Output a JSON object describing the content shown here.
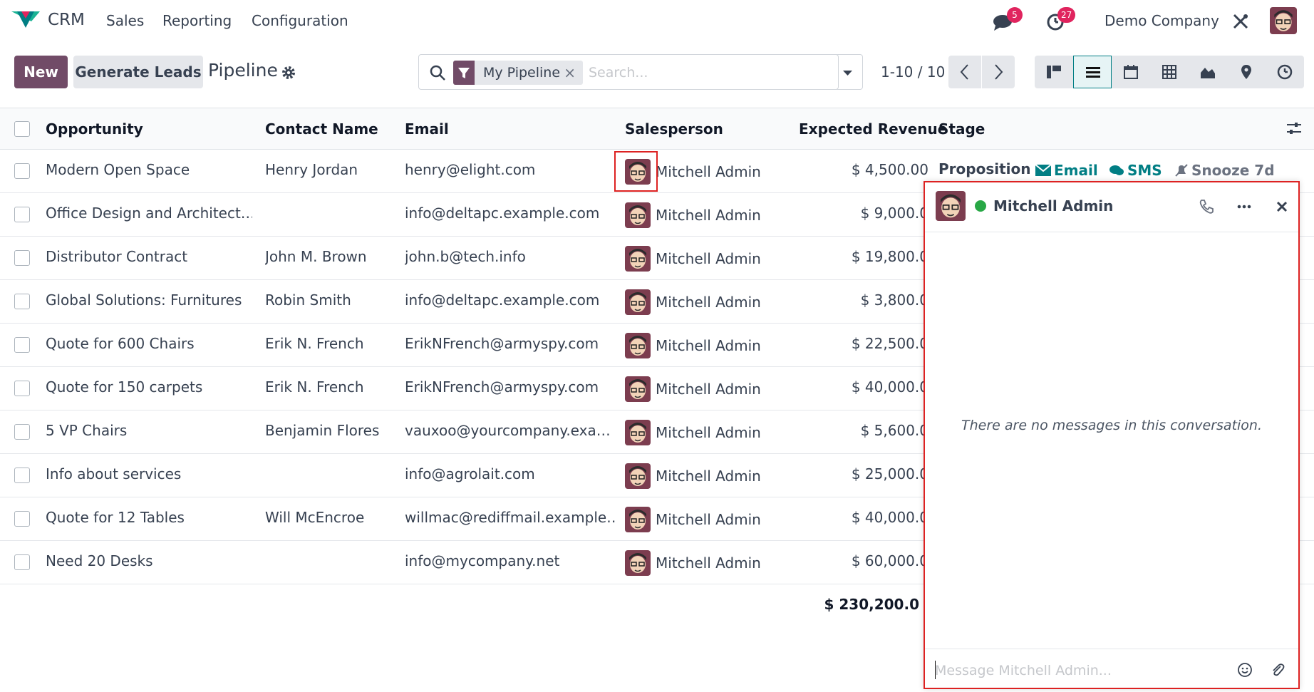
{
  "nav": {
    "app_name": "CRM",
    "menus": [
      "Sales",
      "Reporting",
      "Configuration"
    ],
    "messages_badge": "5",
    "activities_badge": "27",
    "company": "Demo Company",
    "icons": [
      "chat-icon",
      "clock-icon",
      "tools-icon"
    ]
  },
  "control": {
    "new_label": "New",
    "generate_label": "Generate Leads",
    "title": "Pipeline",
    "facet_label": "My Pipeline",
    "facet_close": "×",
    "search_placeholder": "Search...",
    "pager": "1-10 / 10",
    "views": [
      "kanban",
      "list",
      "calendar",
      "pivot",
      "graph",
      "map",
      "activity"
    ],
    "active_view": "list"
  },
  "list": {
    "headers": {
      "opportunity": "Opportunity",
      "contact": "Contact Name",
      "email": "Email",
      "salesperson": "Salesperson",
      "revenue": "Expected Revenue",
      "stage": "Stage"
    },
    "rows": [
      {
        "opportunity": "Modern Open Space",
        "contact": "Henry Jordan",
        "email": "henry@elight.com",
        "salesperson": "Mitchell Admin",
        "revenue": "$ 4,500.00"
      },
      {
        "opportunity": "Office Design and Architect…",
        "contact": "",
        "email": "info@deltapc.example.com",
        "salesperson": "Mitchell Admin",
        "revenue": "$ 9,000.0"
      },
      {
        "opportunity": "Distributor Contract",
        "contact": "John M. Brown",
        "email": "john.b@tech.info",
        "salesperson": "Mitchell Admin",
        "revenue": "$ 19,800.0"
      },
      {
        "opportunity": "Global Solutions: Furnitures",
        "contact": "Robin Smith",
        "email": "info@deltapc.example.com",
        "salesperson": "Mitchell Admin",
        "revenue": "$ 3,800.0"
      },
      {
        "opportunity": "Quote for 600 Chairs",
        "contact": "Erik N. French",
        "email": "ErikNFrench@armyspy.com",
        "salesperson": "Mitchell Admin",
        "revenue": "$ 22,500.0"
      },
      {
        "opportunity": "Quote for 150 carpets",
        "contact": "Erik N. French",
        "email": "ErikNFrench@armyspy.com",
        "salesperson": "Mitchell Admin",
        "revenue": "$ 40,000.0"
      },
      {
        "opportunity": "5 VP Chairs",
        "contact": "Benjamin Flores",
        "email": "vauxoo@yourcompany.exa…",
        "salesperson": "Mitchell Admin",
        "revenue": "$ 5,600.0"
      },
      {
        "opportunity": "Info about services",
        "contact": "",
        "email": "info@agrolait.com",
        "salesperson": "Mitchell Admin",
        "revenue": "$ 25,000.0"
      },
      {
        "opportunity": "Quote for 12 Tables",
        "contact": "Will McEncroe",
        "email": "willmac@rediffmail.example…",
        "salesperson": "Mitchell Admin",
        "revenue": "$ 40,000.0"
      },
      {
        "opportunity": "Need 20 Desks",
        "contact": "",
        "email": "info@mycompany.net",
        "salesperson": "Mitchell Admin",
        "revenue": "$ 60,000.0"
      }
    ],
    "first_row_stage": "Proposition",
    "first_row_actions": {
      "email": "Email",
      "sms": "SMS",
      "snooze": "Snooze 7d"
    },
    "total": "$ 230,200.0"
  },
  "chat": {
    "name": "Mitchell Admin",
    "status_color": "#28a745",
    "empty_text": "There are no messages in this conversation.",
    "input_placeholder": "Message Mitchell Admin..."
  },
  "colors": {
    "brand": "#714b67",
    "accent": "#017e84",
    "highlight": "#dd2222"
  }
}
